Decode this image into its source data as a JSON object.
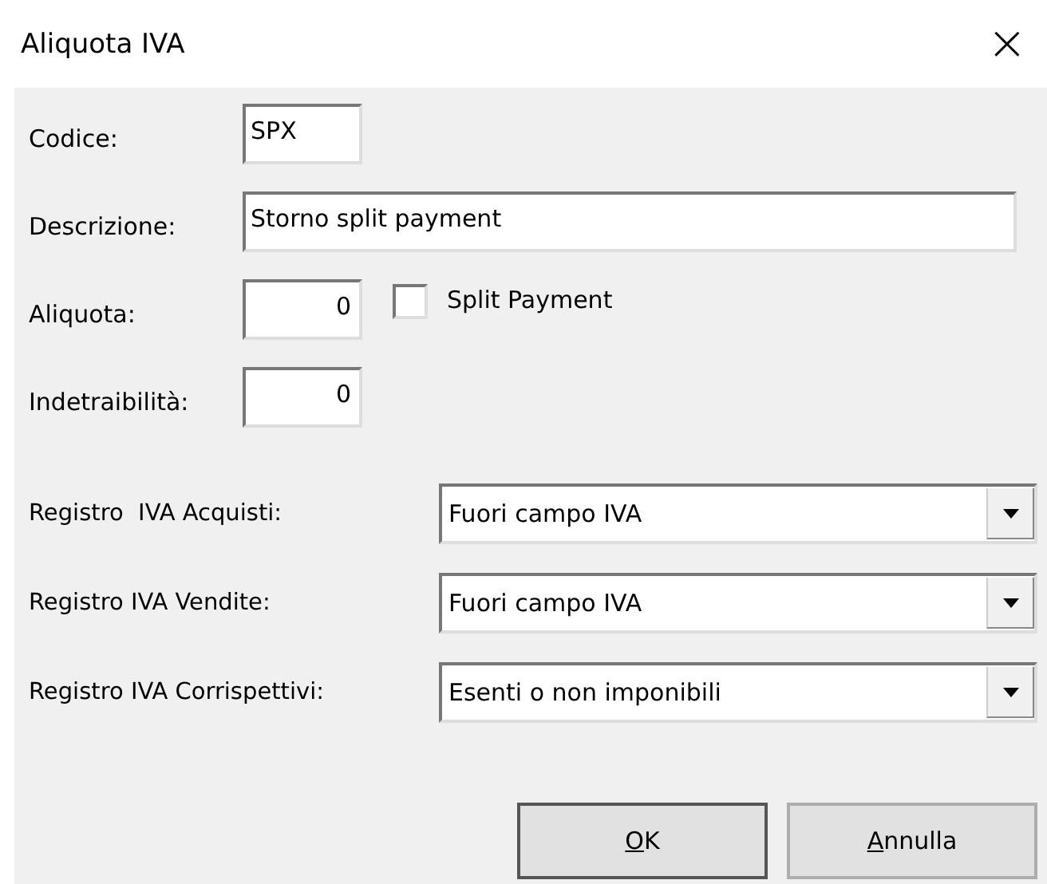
{
  "window": {
    "title": "Aliquota IVA",
    "close": "×"
  },
  "fields": [
    {
      "label": "Codice:",
      "value": "SPX",
      "kind": "code"
    },
    {
      "label": "Descrizione:",
      "value": "Storno split payment",
      "kind": "text"
    },
    {
      "label": "Aliquota:",
      "value": "0",
      "kind": "number",
      "checkbox": {
        "label": "Split Payment",
        "checked": false
      }
    },
    {
      "label": "Indetraibilità:",
      "value": "0",
      "kind": "number"
    }
  ],
  "registri": [
    {
      "label": "Registro  IVA Acquisti:",
      "value": "Fuori campo IVA"
    },
    {
      "label": "Registro IVA Vendite:",
      "value": "Fuori campo IVA"
    },
    {
      "label": "Registro IVA Corrispettivi:",
      "value": "Esenti o non imponibili"
    }
  ],
  "buttons": [
    "OK",
    "Annulla"
  ]
}
